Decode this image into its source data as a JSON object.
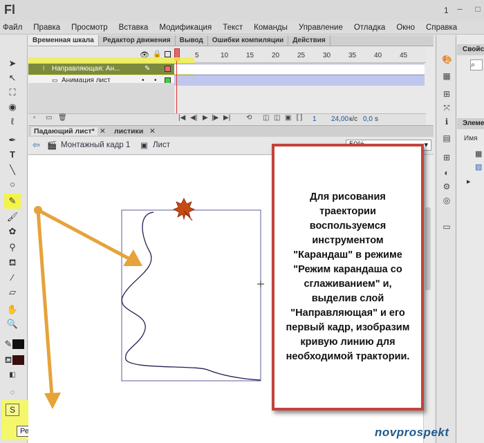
{
  "app": {
    "logo": "Fl",
    "window_number": "1",
    "minimize": "–",
    "maximize": "□",
    "close": "✕"
  },
  "menu": [
    "Файл",
    "Правка",
    "Просмотр",
    "Вставка",
    "Модификация",
    "Текст",
    "Команды",
    "Управление",
    "Отладка",
    "Окно",
    "Справка"
  ],
  "panel_tabs": [
    {
      "label": "Временная шкала",
      "active": true
    },
    {
      "label": "Редактор движения",
      "active": false
    },
    {
      "label": "Вывод",
      "active": false
    },
    {
      "label": "Ошибки компиляции",
      "active": false
    },
    {
      "label": "Действия",
      "active": false
    }
  ],
  "timeline": {
    "frame_numbers": [
      "1",
      "5",
      "10",
      "15",
      "20",
      "25",
      "30",
      "35",
      "40",
      "45"
    ],
    "layers": [
      {
        "name": "Направляющая: Ан...",
        "selected": true,
        "color": "#f06a6a"
      },
      {
        "name": "Анимация лист",
        "selected": false,
        "color": "#3ecf3e"
      }
    ],
    "current_frame": "1",
    "fps": "24,00",
    "fps_unit": "к/с",
    "time": "0,0",
    "time_unit": "s"
  },
  "doc_tabs": [
    {
      "label": "Падающий лист*",
      "active": true
    },
    {
      "label": "листики",
      "active": false
    }
  ],
  "breadcrumb": {
    "scene": "Монтажный кадр 1",
    "symbol": "Лист"
  },
  "zoom": "50%",
  "callout_text": "Для рисования траектории воспользуемся инструментом \"Карандаш\" в режиме \"Режим карандаша со сглаживанием\" и, выделив слой \"Направляющая\" и его первый кадр, изобразим кривую линию для необходимой трактории.",
  "tooltip": "Режим карандаша",
  "right_panel": {
    "tab1": "Свойс",
    "tab2": "Элемен",
    "col_name": "Имя"
  },
  "watermark": "novprospekt",
  "colors": {
    "accent_highlight": "#f3f34a",
    "arrow": "#e6a33a",
    "callout_border": "#c1443c",
    "stroke_swatch": "#111111",
    "fill_swatch": "#3a0d0d"
  }
}
